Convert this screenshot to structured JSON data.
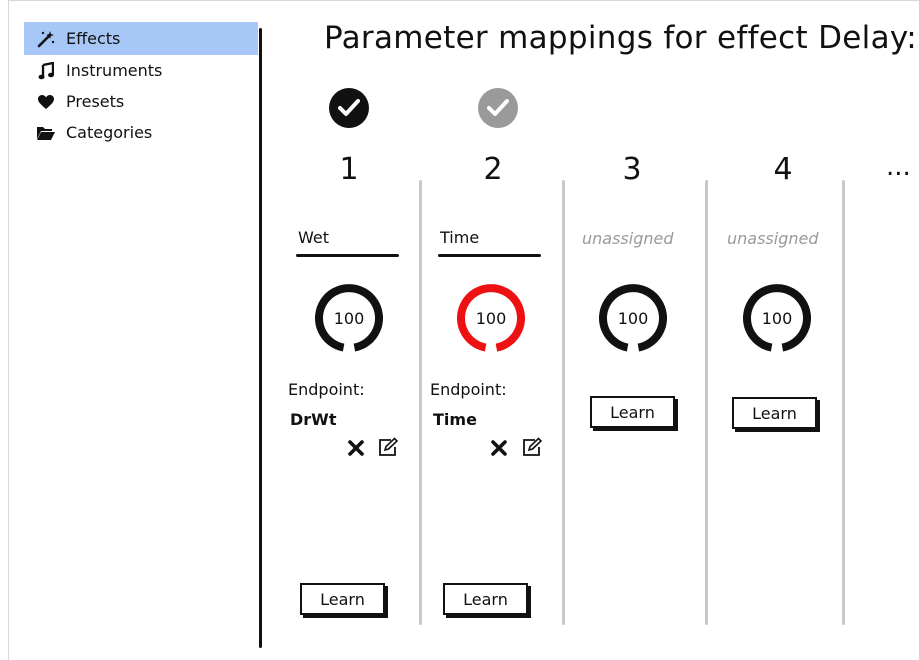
{
  "sidebar": {
    "items": [
      {
        "label": "Effects",
        "icon": "magic-wand-icon",
        "active": true
      },
      {
        "label": "Instruments",
        "icon": "music-note-icon",
        "active": false
      },
      {
        "label": "Presets",
        "icon": "heart-icon",
        "active": false
      },
      {
        "label": "Categories",
        "icon": "folder-open-icon",
        "active": false
      }
    ]
  },
  "page": {
    "title": "Parameter mappings for effect Delay:",
    "more": "..."
  },
  "slots": [
    {
      "number": "1",
      "enabled": true,
      "param": "Wet",
      "knob_value": "100",
      "knob_color": "#111111",
      "endpoint_label": "Endpoint:",
      "endpoint": "DrWt",
      "learn": "Learn"
    },
    {
      "number": "2",
      "enabled": false,
      "param": "Time",
      "knob_value": "100",
      "knob_color": "#ee1111",
      "endpoint_label": "Endpoint:",
      "endpoint": "Time",
      "learn": "Learn"
    },
    {
      "number": "3",
      "param": "unassigned",
      "knob_value": "100",
      "knob_color": "#111111",
      "learn": "Learn"
    },
    {
      "number": "4",
      "param": "unassigned",
      "knob_value": "100",
      "knob_color": "#111111",
      "learn": "Learn"
    }
  ],
  "colors": {
    "active_nav": "#a7c7f7",
    "knob_default": "#111111",
    "knob_active": "#ee1111",
    "unassigned_text": "#9a9a9a",
    "disabled_check": "#9a9a9a"
  }
}
